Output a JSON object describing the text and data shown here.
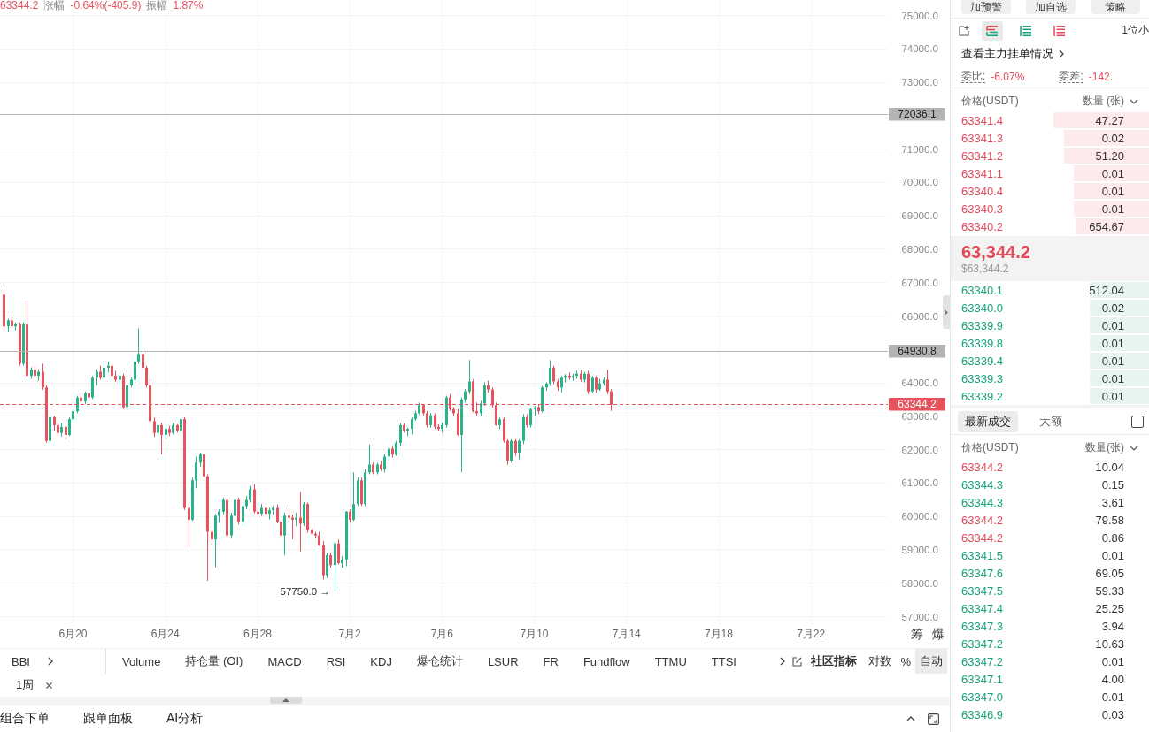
{
  "chart_header": {
    "price": "63344.2",
    "change_label": "涨幅",
    "change": "-0.64%(-405.9)",
    "amplitude_label": "振幅",
    "amplitude": "1.87%"
  },
  "chart": {
    "side_buttons": [
      "筹",
      "爆"
    ],
    "chart_data": [
      {
        "type": "candlestick",
        "grid": true,
        "xlim": [
          "--06-16T20:00",
          "--07-25T08:00"
        ],
        "ylim": [
          56750,
          75450
        ],
        "xticks": [
          {
            "value": "--06-20",
            "label": "6月20"
          },
          {
            "value": "--06-24",
            "label": "6月24"
          },
          {
            "value": "--06-28",
            "label": "6月28"
          },
          {
            "value": "--07-02",
            "label": "7月2"
          },
          {
            "value": "--07-06",
            "label": "7月6"
          },
          {
            "value": "--07-10",
            "label": "7月10"
          },
          {
            "value": "--07-14",
            "label": "7月14"
          },
          {
            "value": "--07-18",
            "label": "7月18"
          },
          {
            "value": "--07-22",
            "label": "7月22"
          }
        ],
        "yticks": [
          {
            "value": 57000,
            "label": "57000.0"
          },
          {
            "value": 58000,
            "label": "58000.0"
          },
          {
            "value": 59000,
            "label": "59000.0"
          },
          {
            "value": 60000,
            "label": "60000.0"
          },
          {
            "value": 61000,
            "label": "61000.0"
          },
          {
            "value": 62000,
            "label": "62000.0"
          },
          {
            "value": 63000,
            "label": "63000.0"
          },
          {
            "value": 64000,
            "label": "64000.0"
          },
          {
            "value": 66000,
            "label": "66000.0"
          },
          {
            "value": 67000,
            "label": "67000.0"
          },
          {
            "value": 68000,
            "label": "68000.0"
          },
          {
            "value": 69000,
            "label": "69000.0"
          },
          {
            "value": 70000,
            "label": "70000.0"
          },
          {
            "value": 71000,
            "label": "71000.0"
          },
          {
            "value": 73000,
            "label": "73000.0"
          },
          {
            "value": 74000,
            "label": "74000.0"
          },
          {
            "value": 75000,
            "label": "75000.0"
          }
        ],
        "ref_lines": [
          {
            "axis": "y",
            "value": 72036.1,
            "label": "72036.1",
            "color": "#b4b4b4",
            "line_style": "solid"
          },
          {
            "axis": "y",
            "value": 64930.8,
            "label": "64930.8",
            "color": "#b4b4b4",
            "line_style": "solid"
          },
          {
            "axis": "y",
            "value": 63344.2,
            "label": "63344.2",
            "color": "#e5535f",
            "line_style": "dashed"
          }
        ],
        "annotations": [
          "57750.0 →"
        ],
        "x": [
          "--06-17T00:00",
          "--06-17T04:00",
          "--06-17T08:00",
          "--06-17T12:00",
          "--06-17T16:00",
          "--06-17T20:00",
          "--06-18T00:00",
          "--06-18T04:00",
          "--06-18T08:00",
          "--06-18T12:00",
          "--06-18T16:00",
          "--06-18T20:00",
          "--06-19T00:00",
          "--06-19T04:00",
          "--06-19T08:00",
          "--06-19T12:00",
          "--06-19T16:00",
          "--06-19T20:00",
          "--06-20T00:00",
          "--06-20T04:00",
          "--06-20T08:00",
          "--06-20T12:00",
          "--06-20T16:00",
          "--06-20T20:00",
          "--06-21T00:00",
          "--06-21T04:00",
          "--06-21T08:00",
          "--06-21T12:00",
          "--06-21T16:00",
          "--06-21T20:00",
          "--06-22T00:00",
          "--06-22T04:00",
          "--06-22T08:00",
          "--06-22T12:00",
          "--06-22T16:00",
          "--06-22T20:00",
          "--06-23T00:00",
          "--06-23T04:00",
          "--06-23T08:00",
          "--06-23T12:00",
          "--06-23T16:00",
          "--06-23T20:00",
          "--06-24T00:00",
          "--06-24T04:00",
          "--06-24T08:00",
          "--06-24T12:00",
          "--06-24T16:00",
          "--06-24T20:00",
          "--06-25T00:00",
          "--06-25T04:00",
          "--06-25T08:00",
          "--06-25T12:00",
          "--06-25T16:00",
          "--06-25T20:00",
          "--06-26T00:00",
          "--06-26T04:00",
          "--06-26T08:00",
          "--06-26T12:00",
          "--06-26T16:00",
          "--06-26T20:00",
          "--06-27T00:00",
          "--06-27T04:00",
          "--06-27T08:00",
          "--06-27T12:00",
          "--06-27T16:00",
          "--06-27T20:00",
          "--06-28T00:00",
          "--06-28T04:00",
          "--06-28T08:00",
          "--06-28T12:00",
          "--06-28T16:00",
          "--06-28T20:00",
          "--06-29T00:00",
          "--06-29T04:00",
          "--06-29T08:00",
          "--06-29T12:00",
          "--06-29T16:00",
          "--06-29T20:00",
          "--06-30T00:00",
          "--06-30T04:00",
          "--06-30T08:00",
          "--06-30T12:00",
          "--06-30T16:00",
          "--06-30T20:00",
          "--07-01T00:00",
          "--07-01T04:00",
          "--07-01T08:00",
          "--07-01T12:00",
          "--07-01T16:00",
          "--07-01T20:00",
          "--07-02T00:00",
          "--07-02T04:00",
          "--07-02T08:00",
          "--07-02T12:00",
          "--07-02T16:00",
          "--07-02T20:00",
          "--07-03T00:00",
          "--07-03T04:00",
          "--07-03T08:00",
          "--07-03T12:00",
          "--07-03T16:00",
          "--07-03T20:00",
          "--07-04T00:00",
          "--07-04T04:00",
          "--07-04T08:00",
          "--07-04T12:00",
          "--07-04T16:00",
          "--07-04T20:00",
          "--07-05T00:00",
          "--07-05T04:00",
          "--07-05T08:00",
          "--07-05T12:00",
          "--07-05T16:00",
          "--07-05T20:00",
          "--07-06T00:00",
          "--07-06T04:00",
          "--07-06T08:00",
          "--07-06T12:00",
          "--07-06T16:00",
          "--07-06T20:00",
          "--07-07T00:00",
          "--07-07T04:00",
          "--07-07T08:00",
          "--07-07T12:00",
          "--07-07T16:00",
          "--07-07T20:00",
          "--07-08T00:00",
          "--07-08T04:00",
          "--07-08T08:00",
          "--07-08T12:00",
          "--07-08T16:00",
          "--07-08T20:00",
          "--07-09T00:00",
          "--07-09T04:00",
          "--07-09T08:00",
          "--07-09T12:00",
          "--07-09T16:00",
          "--07-09T20:00",
          "--07-10T00:00",
          "--07-10T04:00",
          "--07-10T08:00",
          "--07-10T12:00",
          "--07-10T16:00",
          "--07-10T20:00",
          "--07-11T00:00",
          "--07-11T04:00",
          "--07-11T08:00",
          "--07-11T12:00",
          "--07-11T16:00",
          "--07-11T20:00",
          "--07-12T00:00",
          "--07-12T04:00",
          "--07-12T08:00",
          "--07-12T12:00",
          "--07-12T16:00",
          "--07-12T20:00",
          "--07-13T00:00",
          "--07-13T04:00",
          "--07-13T08:00"
        ],
        "ohlc": [
          [
            66630,
            66800,
            65560,
            65680
          ],
          [
            65680,
            65900,
            65500,
            65860
          ],
          [
            65860,
            65950,
            65620,
            65680
          ],
          [
            65680,
            65800,
            65560,
            65740
          ],
          [
            65740,
            65800,
            64500,
            64560
          ],
          [
            64560,
            65800,
            64500,
            65740
          ],
          [
            65740,
            66450,
            64150,
            64200
          ],
          [
            64200,
            64450,
            64100,
            64380
          ],
          [
            64380,
            64500,
            64150,
            64200
          ],
          [
            64200,
            64400,
            64050,
            64320
          ],
          [
            64320,
            64560,
            63780,
            63850
          ],
          [
            63850,
            63910,
            62200,
            62250
          ],
          [
            62250,
            63020,
            62150,
            62960
          ],
          [
            62960,
            63000,
            62550,
            62720
          ],
          [
            62720,
            62800,
            62400,
            62490
          ],
          [
            62490,
            62780,
            62380,
            62670
          ],
          [
            62670,
            62720,
            62300,
            62430
          ],
          [
            62430,
            62950,
            62400,
            62900
          ],
          [
            62900,
            63200,
            62780,
            63140
          ],
          [
            63140,
            63600,
            63080,
            63550
          ],
          [
            63550,
            63700,
            63380,
            63430
          ],
          [
            63430,
            63730,
            63350,
            63670
          ],
          [
            63670,
            63720,
            63450,
            63550
          ],
          [
            63550,
            64200,
            63500,
            64140
          ],
          [
            64140,
            64400,
            63900,
            64320
          ],
          [
            64320,
            64500,
            64080,
            64140
          ],
          [
            64140,
            64560,
            64100,
            64440
          ],
          [
            64440,
            64620,
            64300,
            64500
          ],
          [
            64500,
            64560,
            64150,
            64200
          ],
          [
            64200,
            64350,
            64020,
            64080
          ],
          [
            64080,
            64300,
            63950,
            64200
          ],
          [
            64200,
            64260,
            63200,
            63260
          ],
          [
            63260,
            63950,
            63200,
            63910
          ],
          [
            63910,
            64150,
            63850,
            64080
          ],
          [
            64080,
            64700,
            64000,
            64620
          ],
          [
            64620,
            65620,
            64560,
            64850
          ],
          [
            64850,
            64900,
            64350,
            64440
          ],
          [
            64440,
            64500,
            63850,
            63910
          ],
          [
            63910,
            64100,
            62780,
            62840
          ],
          [
            62840,
            62950,
            62370,
            62490
          ],
          [
            62490,
            62780,
            62400,
            62720
          ],
          [
            62720,
            62800,
            61850,
            62430
          ],
          [
            62430,
            62720,
            62300,
            62610
          ],
          [
            62610,
            62700,
            62400,
            62490
          ],
          [
            62490,
            62780,
            62450,
            62720
          ],
          [
            62720,
            62750,
            62500,
            62550
          ],
          [
            62550,
            62900,
            62480,
            62900
          ],
          [
            62900,
            62960,
            60180,
            60240
          ],
          [
            60240,
            60300,
            59060,
            59890
          ],
          [
            59890,
            61150,
            59850,
            61070
          ],
          [
            61070,
            61780,
            60830,
            61600
          ],
          [
            61600,
            61900,
            61480,
            61840
          ],
          [
            61840,
            61850,
            61150,
            61190
          ],
          [
            61190,
            61250,
            58060,
            59530
          ],
          [
            59530,
            59600,
            59250,
            59300
          ],
          [
            59300,
            60060,
            58470,
            60010
          ],
          [
            60010,
            60200,
            59800,
            60130
          ],
          [
            60130,
            60540,
            60050,
            60480
          ],
          [
            60480,
            60520,
            59350,
            59420
          ],
          [
            59420,
            60100,
            59350,
            60010
          ],
          [
            60010,
            60550,
            59950,
            60480
          ],
          [
            60480,
            60550,
            59750,
            59830
          ],
          [
            59830,
            60350,
            59700,
            60300
          ],
          [
            60300,
            60600,
            60200,
            60480
          ],
          [
            60480,
            60900,
            60400,
            60800
          ],
          [
            60800,
            60950,
            60080,
            60130
          ],
          [
            60130,
            60250,
            59950,
            60070
          ],
          [
            60070,
            60360,
            60000,
            60240
          ],
          [
            60240,
            60300,
            60000,
            60070
          ],
          [
            60070,
            60250,
            59900,
            60180
          ],
          [
            60180,
            60300,
            60050,
            60240
          ],
          [
            60240,
            60350,
            59780,
            59830
          ],
          [
            59830,
            59900,
            59350,
            59420
          ],
          [
            59420,
            60100,
            58830,
            60010
          ],
          [
            60010,
            60240,
            59900,
            59950
          ],
          [
            59950,
            60050,
            59300,
            59890
          ],
          [
            59890,
            60100,
            59700,
            59950
          ],
          [
            59950,
            60720,
            58940,
            59770
          ],
          [
            59770,
            60420,
            59700,
            60360
          ],
          [
            60360,
            60400,
            59500,
            59590
          ],
          [
            59590,
            59650,
            59400,
            59470
          ],
          [
            59470,
            59530,
            59350,
            59420
          ],
          [
            59420,
            59530,
            59100,
            59120
          ],
          [
            59120,
            59250,
            58100,
            58230
          ],
          [
            58230,
            58900,
            58150,
            58830
          ],
          [
            58830,
            58900,
            58450,
            58530
          ],
          [
            58530,
            59250,
            57750,
            59180
          ],
          [
            59180,
            59300,
            58550,
            58590
          ],
          [
            58590,
            58800,
            58450,
            58700
          ],
          [
            58700,
            60150,
            58500,
            60130
          ],
          [
            60130,
            60200,
            59800,
            59890
          ],
          [
            59890,
            61310,
            59850,
            60360
          ],
          [
            60360,
            61150,
            60300,
            61070
          ],
          [
            61070,
            61150,
            60300,
            60360
          ],
          [
            60360,
            61400,
            60300,
            61310
          ],
          [
            61310,
            62140,
            61250,
            61540
          ],
          [
            61540,
            61600,
            61250,
            61310
          ],
          [
            61310,
            61600,
            61250,
            61540
          ],
          [
            61540,
            61650,
            61350,
            61400
          ],
          [
            61400,
            61850,
            61300,
            61780
          ],
          [
            61780,
            62080,
            61650,
            62020
          ],
          [
            62020,
            62100,
            61750,
            61840
          ],
          [
            61840,
            62250,
            61800,
            62190
          ],
          [
            62190,
            62780,
            62100,
            62720
          ],
          [
            62720,
            62780,
            62500,
            62550
          ],
          [
            62550,
            62650,
            62400,
            62610
          ],
          [
            62610,
            62950,
            62450,
            62900
          ],
          [
            62900,
            63150,
            62850,
            63080
          ],
          [
            63080,
            63400,
            63050,
            63320
          ],
          [
            63320,
            63350,
            63000,
            63080
          ],
          [
            63080,
            63150,
            62650,
            62720
          ],
          [
            62720,
            63080,
            62650,
            63020
          ],
          [
            63020,
            63080,
            62600,
            62670
          ],
          [
            62670,
            62750,
            62550,
            62610
          ],
          [
            62610,
            62800,
            62500,
            62720
          ],
          [
            62720,
            63600,
            62650,
            63550
          ],
          [
            63550,
            63650,
            63150,
            63200
          ],
          [
            63200,
            63260,
            63000,
            63080
          ],
          [
            63080,
            63200,
            62400,
            62430
          ],
          [
            62430,
            63550,
            61310,
            63490
          ],
          [
            63490,
            63800,
            63400,
            63730
          ],
          [
            63730,
            64670,
            63650,
            64030
          ],
          [
            64030,
            64100,
            63100,
            63140
          ],
          [
            63140,
            63400,
            63000,
            63080
          ],
          [
            63080,
            63450,
            63000,
            63370
          ],
          [
            63370,
            64000,
            63300,
            63910
          ],
          [
            63910,
            64050,
            63700,
            63790
          ],
          [
            63790,
            63850,
            63250,
            63320
          ],
          [
            63320,
            63400,
            62700,
            62720
          ],
          [
            62720,
            62950,
            62600,
            62900
          ],
          [
            62900,
            62950,
            62200,
            62250
          ],
          [
            62250,
            62300,
            61540,
            61660
          ],
          [
            61660,
            62300,
            61600,
            62250
          ],
          [
            62250,
            62300,
            61800,
            61900
          ],
          [
            61900,
            62300,
            61700,
            62250
          ],
          [
            62250,
            63050,
            62150,
            62960
          ],
          [
            62960,
            63050,
            62650,
            62720
          ],
          [
            62720,
            63250,
            62650,
            63200
          ],
          [
            63200,
            63300,
            63000,
            63260
          ],
          [
            63260,
            63350,
            63050,
            63140
          ],
          [
            63140,
            63900,
            63100,
            63850
          ],
          [
            63850,
            64000,
            63750,
            63970
          ],
          [
            63970,
            64670,
            63900,
            64440
          ],
          [
            64440,
            64500,
            63950,
            64030
          ],
          [
            64030,
            64100,
            63750,
            63850
          ],
          [
            63850,
            64200,
            63700,
            64140
          ],
          [
            64140,
            64250,
            64000,
            64200
          ],
          [
            64200,
            64300,
            64080,
            64140
          ],
          [
            64140,
            64260,
            64050,
            64200
          ],
          [
            64200,
            64350,
            64100,
            64260
          ],
          [
            64260,
            64380,
            64020,
            64080
          ],
          [
            64080,
            64320,
            64000,
            64260
          ],
          [
            64260,
            64350,
            63650,
            63730
          ],
          [
            63730,
            64200,
            63680,
            64140
          ],
          [
            64140,
            64200,
            63700,
            63790
          ],
          [
            63790,
            64100,
            63750,
            63970
          ],
          [
            63970,
            64150,
            63900,
            64080
          ],
          [
            64080,
            64380,
            63650,
            63730
          ],
          [
            63730,
            63800,
            63150,
            63344.2
          ]
        ]
      }
    ]
  },
  "indicator_bar": {
    "main_indicators": [
      "BBI"
    ],
    "sub_indicators": [
      "Volume",
      "持仓量 (OI)",
      "MACD",
      "RSI",
      "KDJ",
      "爆仓统计",
      "LSUR",
      "FR",
      "Fundflow",
      "TTMU",
      "TTSI"
    ],
    "community_label": "社区指标",
    "scale_modes": [
      {
        "label": "对数",
        "selected": false
      },
      {
        "label": "%",
        "selected": false
      },
      {
        "label": "自动",
        "selected": true
      }
    ]
  },
  "period_tags": [
    "1周"
  ],
  "bottom_tabs": [
    "组合下单",
    "跟单面板",
    "AI分析"
  ],
  "side_panel": {
    "top_buttons": [
      "加预警",
      "加自选",
      "策略"
    ],
    "book_views": [
      {
        "kind": "both",
        "selected": true
      },
      {
        "kind": "bids",
        "selected": false
      },
      {
        "kind": "asks",
        "selected": false
      }
    ],
    "precision": "1位小",
    "main_orders_link": "查看主力挂单情况",
    "bid_ask_ratio": {
      "label": "委比:",
      "value": "-6.07%"
    },
    "bid_ask_diff": {
      "label": "委差:",
      "value": "-142."
    },
    "book_columns": [
      "价格(USDT)",
      "数量 (张)"
    ],
    "asks": [
      {
        "price": "63341.4",
        "amount": "47.27",
        "level": 0.48
      },
      {
        "price": "63341.3",
        "amount": "0.02",
        "level": 0.43
      },
      {
        "price": "63341.2",
        "amount": "51.20",
        "level": 0.43
      },
      {
        "price": "63341.1",
        "amount": "0.01",
        "level": 0.38
      },
      {
        "price": "63340.4",
        "amount": "0.01",
        "level": 0.38
      },
      {
        "price": "63340.3",
        "amount": "0.01",
        "level": 0.38
      },
      {
        "price": "63340.2",
        "amount": "654.67",
        "level": 0.37
      }
    ],
    "last_price": "63,344.2",
    "last_price_usd": "$63,344.2",
    "bids": [
      {
        "price": "63340.1",
        "amount": "512.04",
        "level": 0.3
      },
      {
        "price": "63340.0",
        "amount": "0.02",
        "level": 0.3
      },
      {
        "price": "63339.9",
        "amount": "0.01",
        "level": 0.3
      },
      {
        "price": "63339.8",
        "amount": "0.01",
        "level": 0.3
      },
      {
        "price": "63339.4",
        "amount": "0.01",
        "level": 0.3
      },
      {
        "price": "63339.3",
        "amount": "0.01",
        "level": 0.3
      },
      {
        "price": "63339.2",
        "amount": "0.01",
        "level": 0.3
      }
    ],
    "trade_tabs": [
      {
        "label": "最新成交",
        "selected": true
      },
      {
        "label": "大额",
        "selected": false
      }
    ],
    "filter_checkbox": {
      "checked": false
    },
    "trade_columns": [
      "价格(USDT)",
      "数量(张)"
    ],
    "trades": [
      {
        "price": "63344.2",
        "amount": "10.04",
        "color": "#e24a5a"
      },
      {
        "price": "63344.3",
        "amount": "0.15",
        "color": "#17a37b"
      },
      {
        "price": "63344.3",
        "amount": "3.61",
        "color": "#17a37b"
      },
      {
        "price": "63344.2",
        "amount": "79.58",
        "color": "#e24a5a"
      },
      {
        "price": "63344.2",
        "amount": "0.86",
        "color": "#e24a5a"
      },
      {
        "price": "63341.5",
        "amount": "0.01",
        "color": "#17a37b"
      },
      {
        "price": "63347.6",
        "amount": "69.05",
        "color": "#17a37b"
      },
      {
        "price": "63347.5",
        "amount": "59.33",
        "color": "#17a37b"
      },
      {
        "price": "63347.4",
        "amount": "25.25",
        "color": "#17a37b"
      },
      {
        "price": "63347.3",
        "amount": "3.94",
        "color": "#17a37b"
      },
      {
        "price": "63347.2",
        "amount": "10.63",
        "color": "#17a37b"
      },
      {
        "price": "63347.2",
        "amount": "0.01",
        "color": "#17a37b"
      },
      {
        "price": "63347.1",
        "amount": "4.00",
        "color": "#17a37b"
      },
      {
        "price": "63347.0",
        "amount": "0.01",
        "color": "#17a37b"
      },
      {
        "price": "63346.9",
        "amount": "0.03",
        "color": "#17a37b"
      }
    ]
  }
}
